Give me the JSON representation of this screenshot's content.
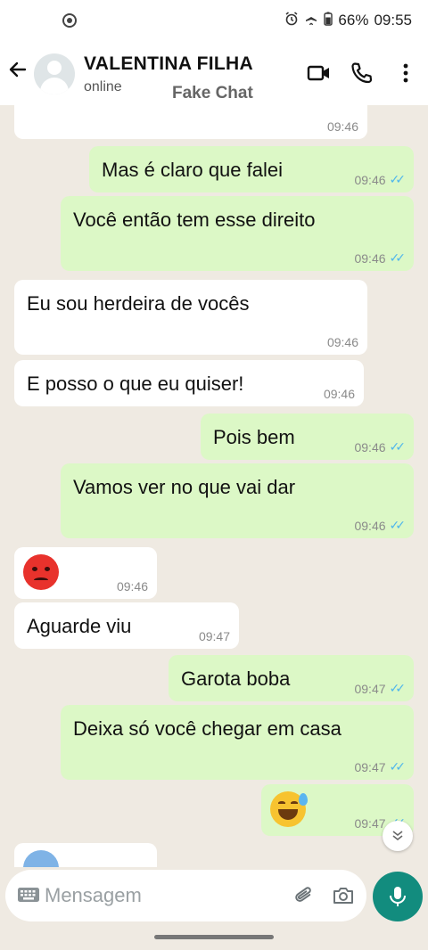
{
  "status_bar": {
    "battery": "66%",
    "time": "09:55",
    "icons": [
      "alarm-icon",
      "airplane-icon",
      "battery-icon"
    ]
  },
  "header": {
    "contact_name": "VALENTINA FILHA",
    "status": "online",
    "watermark": "Fake Chat",
    "icons": [
      "back-arrow-icon",
      "avatar",
      "video-call-icon",
      "phone-call-icon",
      "more-options-icon"
    ]
  },
  "messages": [
    {
      "dir": "in",
      "text": "",
      "time": "09:46"
    },
    {
      "dir": "out",
      "text": "Mas é claro que falei",
      "time": "09:46",
      "read": true
    },
    {
      "dir": "out",
      "text": "Você então tem esse direito",
      "time": "09:46",
      "read": true
    },
    {
      "dir": "in",
      "text": "Eu sou herdeira de vocês",
      "time": "09:46"
    },
    {
      "dir": "in",
      "text": "E posso o que eu quiser!",
      "time": "09:46"
    },
    {
      "dir": "out",
      "text": "Pois bem",
      "time": "09:46",
      "read": true
    },
    {
      "dir": "out",
      "text": "Vamos ver no que vai dar",
      "time": "09:46",
      "read": true
    },
    {
      "dir": "in",
      "emoji": "angry-face",
      "time": "09:46"
    },
    {
      "dir": "in",
      "text": "Aguarde viu",
      "time": "09:47"
    },
    {
      "dir": "out",
      "text": "Garota boba",
      "time": "09:47",
      "read": true
    },
    {
      "dir": "out",
      "text": "Deixa só você chegar em casa",
      "time": "09:47",
      "read": true
    },
    {
      "dir": "out",
      "emoji": "grinning-sweat-face",
      "time": "09:47",
      "read": true
    },
    {
      "dir": "in",
      "emoji": "cold-face",
      "time": ""
    }
  ],
  "input": {
    "placeholder": "Mensagem",
    "icons": [
      "keyboard-icon",
      "attach-icon",
      "camera-icon",
      "mic-icon"
    ]
  },
  "colors": {
    "outgoing_bubble": "#dcf8c6",
    "incoming_bubble": "#ffffff",
    "chat_background": "#efeae2",
    "read_ticks": "#4fb6ec",
    "mic_button": "#128c7e"
  }
}
